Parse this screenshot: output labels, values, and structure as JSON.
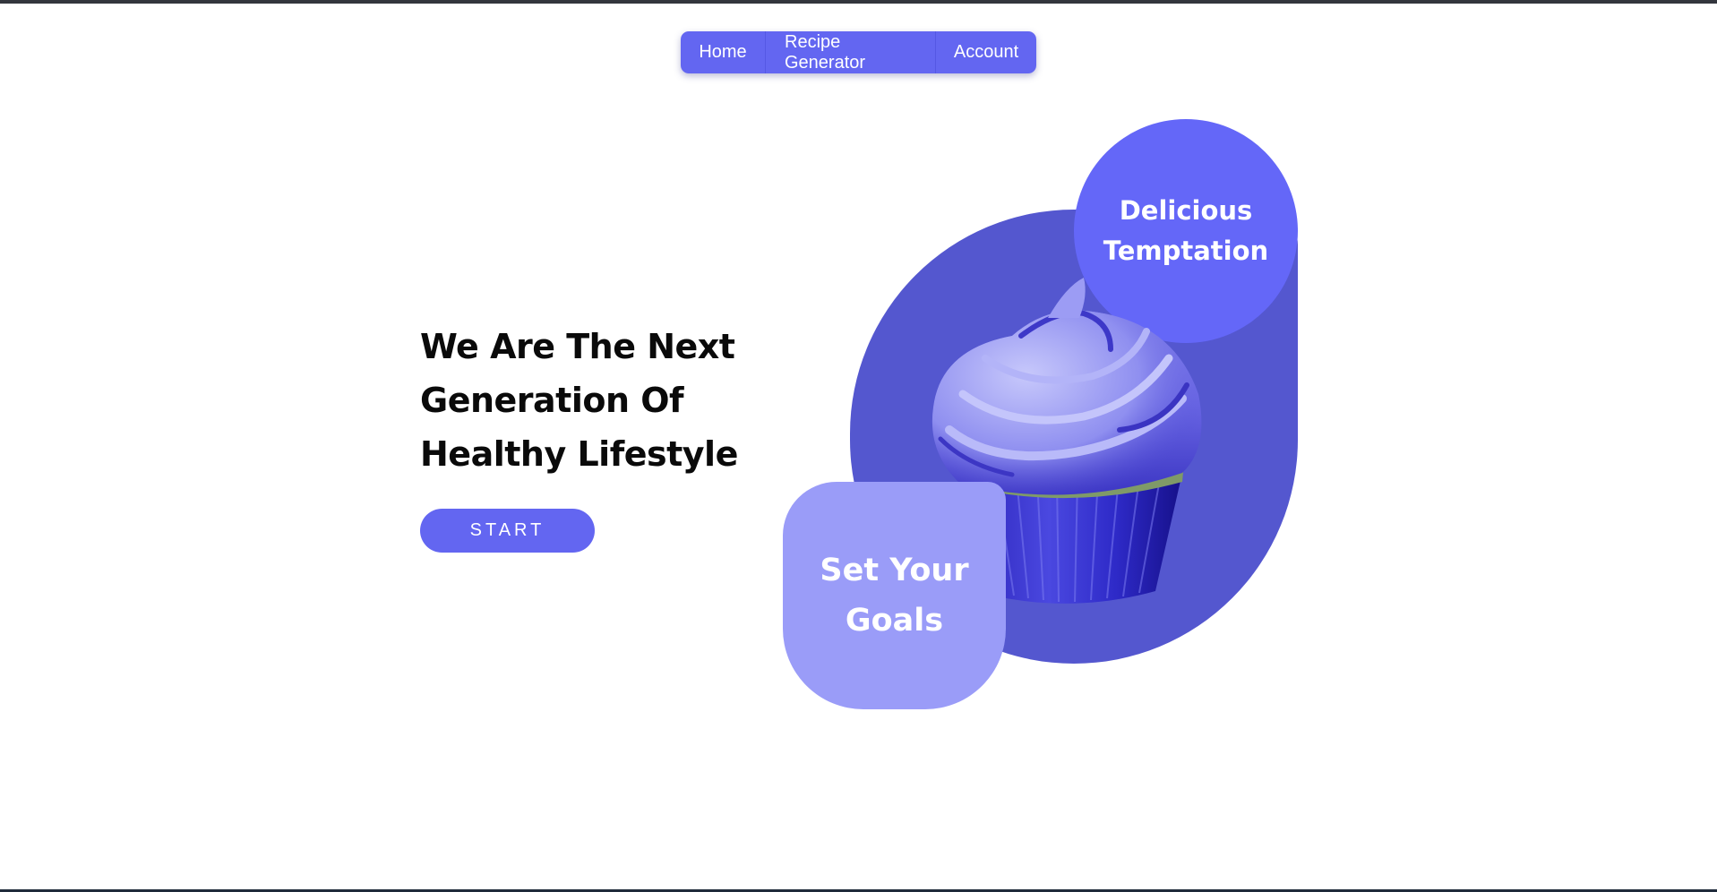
{
  "nav": {
    "items": [
      {
        "label": "Home"
      },
      {
        "label": "Recipe Generator"
      },
      {
        "label": "Account"
      }
    ]
  },
  "hero": {
    "title": "We Are The Next Generation Of Healthy Lifestyle",
    "start_label": "START"
  },
  "graphic": {
    "bubble_text": "Delicious Temptation",
    "card_text": "Set Your Goals",
    "image": "cupcake-image"
  },
  "colors": {
    "accent": "#6366f1",
    "shape": "#5457cf",
    "card": "#9a9cf8",
    "bubble": "#6467f8"
  }
}
